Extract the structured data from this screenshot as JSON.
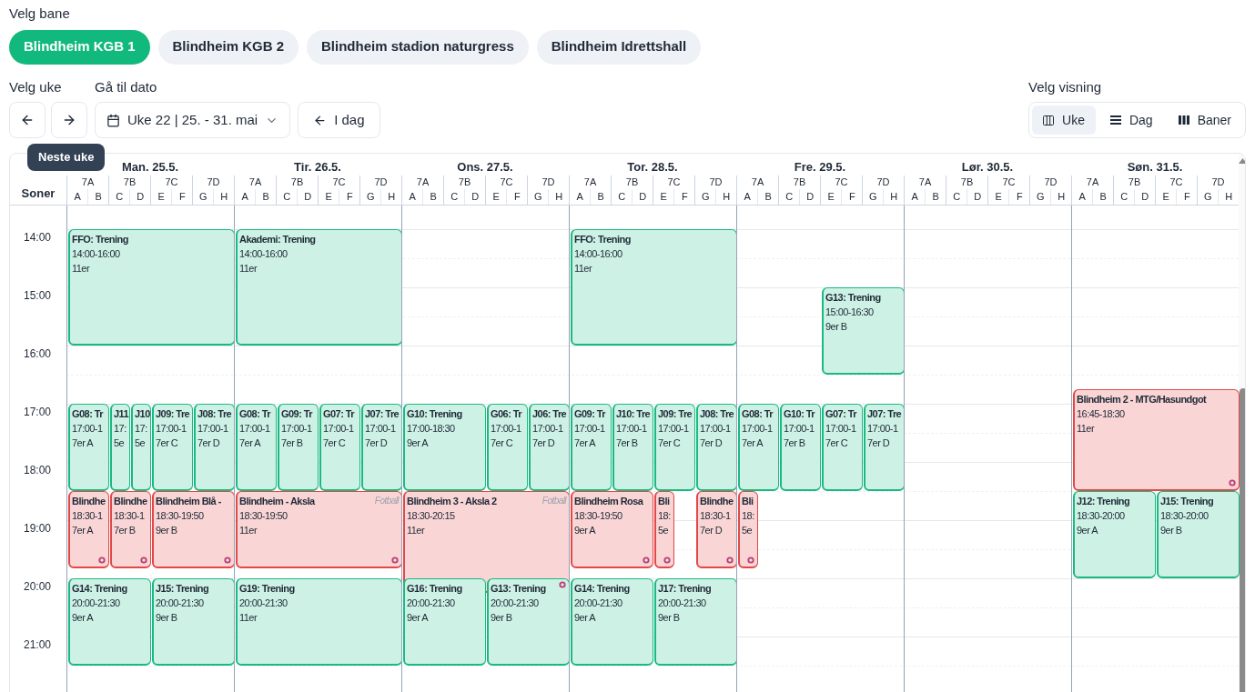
{
  "field_picker": {
    "label": "Velg bane",
    "options": [
      {
        "label": "Blindheim KGB 1",
        "selected": true
      },
      {
        "label": "Blindheim KGB 2",
        "selected": false
      },
      {
        "label": "Blindheim stadion naturgress",
        "selected": false
      },
      {
        "label": "Blindheim Idrettshall",
        "selected": false
      }
    ]
  },
  "week_picker": {
    "label": "Velg uke",
    "date_label": "Gå til dato",
    "date_value": "Uke 22 | 25. - 31. mai",
    "today_button": "I dag",
    "tooltip": "Neste uke"
  },
  "view_picker": {
    "label": "Velg visning",
    "options": [
      {
        "label": "Uke",
        "selected": true,
        "kind": "week"
      },
      {
        "label": "Dag",
        "selected": false,
        "kind": "day"
      },
      {
        "label": "Baner",
        "selected": false,
        "kind": "fields"
      }
    ]
  },
  "calendar": {
    "zones_label": "Soner",
    "times": [
      "14:00",
      "15:00",
      "16:00",
      "17:00",
      "18:00",
      "19:00",
      "20:00",
      "21:00"
    ],
    "days": [
      {
        "label": "Man. 25.5.",
        "groups": [
          {
            "label": "7A",
            "zones": [
              "A",
              "B"
            ]
          },
          {
            "label": "7B",
            "zones": [
              "C",
              "D"
            ]
          },
          {
            "label": "7C",
            "zones": [
              "E",
              "F"
            ]
          },
          {
            "label": "7D",
            "zones": [
              "G",
              "H"
            ]
          }
        ],
        "events": [
          {
            "title": "FFO: Trening",
            "time": "14:00-16:00",
            "team": "11er",
            "kind": "training"
          },
          {
            "title": "G08: Tr",
            "time": "17:00-1",
            "team": "7er A",
            "kind": "training"
          },
          {
            "title": "J11",
            "time": "17:",
            "team": "5e",
            "kind": "training"
          },
          {
            "title": "J10",
            "time": "17:",
            "team": "5e",
            "kind": "training"
          },
          {
            "title": "J09: Tre",
            "time": "17:00-1",
            "team": "7er C",
            "kind": "training"
          },
          {
            "title": "J08: Tre",
            "time": "17:00-1",
            "team": "7er D",
            "kind": "training"
          },
          {
            "title": "Blindhe",
            "time": "18:30-1",
            "team": "7er A",
            "kind": "match"
          },
          {
            "title": "Blindhe",
            "time": "18:30-1",
            "team": "7er B",
            "kind": "match"
          },
          {
            "title": "Blindheim Blå -",
            "time": "18:30-19:50",
            "team": "9er B",
            "kind": "match"
          },
          {
            "title": "G14: Trening",
            "time": "20:00-21:30",
            "team": "9er A",
            "kind": "training"
          },
          {
            "title": "J15: Trening",
            "time": "20:00-21:30",
            "team": "9er B",
            "kind": "training"
          }
        ]
      },
      {
        "label": "Tir. 26.5.",
        "groups": [
          {
            "label": "7A",
            "zones": [
              "A",
              "B"
            ]
          },
          {
            "label": "7B",
            "zones": [
              "C",
              "D"
            ]
          },
          {
            "label": "7C",
            "zones": [
              "E",
              "F"
            ]
          },
          {
            "label": "7D",
            "zones": [
              "G",
              "H"
            ]
          }
        ],
        "events": [
          {
            "title": "Akademi: Trening",
            "time": "14:00-16:00",
            "team": "11er",
            "kind": "training"
          },
          {
            "title": "G08: Tr",
            "time": "17:00-1",
            "team": "7er A",
            "kind": "training"
          },
          {
            "title": "G09: Tr",
            "time": "17:00-1",
            "team": "7er B",
            "kind": "training"
          },
          {
            "title": "G07: Tr",
            "time": "17:00-1",
            "team": "7er C",
            "kind": "training"
          },
          {
            "title": "J07: Tre",
            "time": "17:00-1",
            "team": "7er D",
            "kind": "training"
          },
          {
            "title": "Blindheim - Aksla",
            "tag": "Fotball",
            "time": "18:30-19:50",
            "team": "11er",
            "kind": "match"
          },
          {
            "title": "G19: Trening",
            "time": "20:00-21:30",
            "team": "11er",
            "kind": "training"
          }
        ]
      },
      {
        "label": "Ons. 27.5.",
        "groups": [
          {
            "label": "7A",
            "zones": [
              "A",
              "B"
            ]
          },
          {
            "label": "7B",
            "zones": [
              "C",
              "D"
            ]
          },
          {
            "label": "7C",
            "zones": [
              "E",
              "F"
            ]
          },
          {
            "label": "7D",
            "zones": [
              "G",
              "H"
            ]
          }
        ],
        "events": [
          {
            "title": "G10: Trening",
            "time": "17:00-18:30",
            "team": "9er A",
            "kind": "training"
          },
          {
            "title": "G06: Tr",
            "time": "17:00-1",
            "team": "7er C",
            "kind": "training"
          },
          {
            "title": "J06: Tre",
            "time": "17:00-1",
            "team": "7er D",
            "kind": "training"
          },
          {
            "title": "Blindheim 3 - Aksla 2",
            "tag": "Fotball",
            "time": "18:30-20:15",
            "team": "11er",
            "kind": "match"
          },
          {
            "title": "G16: Trening",
            "time": "20:00-21:30",
            "team": "9er A",
            "kind": "training"
          },
          {
            "title": "G13: Trening",
            "time": "20:00-21:30",
            "team": "9er B",
            "kind": "training"
          }
        ]
      },
      {
        "label": "Tor. 28.5.",
        "groups": [
          {
            "label": "7A",
            "zones": [
              "A",
              "B"
            ]
          },
          {
            "label": "7B",
            "zones": [
              "C",
              "D"
            ]
          },
          {
            "label": "7C",
            "zones": [
              "E",
              "F"
            ]
          },
          {
            "label": "7D",
            "zones": [
              "G",
              "H"
            ]
          }
        ],
        "events": [
          {
            "title": "FFO: Trening",
            "time": "14:00-16:00",
            "team": "11er",
            "kind": "training"
          },
          {
            "title": "G09: Tr",
            "time": "17:00-1",
            "team": "7er A",
            "kind": "training"
          },
          {
            "title": "J10: Tre",
            "time": "17:00-1",
            "team": "7er B",
            "kind": "training"
          },
          {
            "title": "J09: Tre",
            "time": "17:00-1",
            "team": "7er C",
            "kind": "training"
          },
          {
            "title": "J08: Tre",
            "time": "17:00-1",
            "team": "7er D",
            "kind": "training"
          },
          {
            "title": "Blindheim Rosa",
            "time": "18:30-19:50",
            "team": "9er A",
            "kind": "match"
          },
          {
            "title": "Bli",
            "time": "18:",
            "team": "5e",
            "kind": "match"
          },
          {
            "title": "Blindhe",
            "time": "18:30-1",
            "team": "7er D",
            "kind": "match"
          },
          {
            "title": "G14: Trening",
            "time": "20:00-21:30",
            "team": "9er A",
            "kind": "training"
          },
          {
            "title": "J17: Trening",
            "time": "20:00-21:30",
            "team": "9er B",
            "kind": "training"
          }
        ]
      },
      {
        "label": "Fre. 29.5.",
        "groups": [
          {
            "label": "7A",
            "zones": [
              "A",
              "B"
            ]
          },
          {
            "label": "7B",
            "zones": [
              "C",
              "D"
            ]
          },
          {
            "label": "7C",
            "zones": [
              "E",
              "F"
            ]
          },
          {
            "label": "7D",
            "zones": [
              "G",
              "H"
            ]
          }
        ],
        "events": [
          {
            "title": "G13: Trening",
            "time": "15:00-16:30",
            "team": "9er B",
            "kind": "training"
          },
          {
            "title": "G08: Tr",
            "time": "17:00-1",
            "team": "7er A",
            "kind": "training"
          },
          {
            "title": "G10: Tr",
            "time": "17:00-1",
            "team": "7er B",
            "kind": "training"
          },
          {
            "title": "G07: Tr",
            "time": "17:00-1",
            "team": "7er C",
            "kind": "training"
          },
          {
            "title": "J07: Tre",
            "time": "17:00-1",
            "team": "7er D",
            "kind": "training"
          },
          {
            "title": "Bli",
            "time": "18:",
            "team": "5e",
            "kind": "match"
          }
        ]
      },
      {
        "label": "Lør. 30.5.",
        "groups": [
          {
            "label": "7A",
            "zones": [
              "A",
              "B"
            ]
          },
          {
            "label": "7B",
            "zones": [
              "C",
              "D"
            ]
          },
          {
            "label": "7C",
            "zones": [
              "E",
              "F"
            ]
          },
          {
            "label": "7D",
            "zones": [
              "G",
              "H"
            ]
          }
        ]
      },
      {
        "label": "Søn. 31.5.",
        "groups": [
          {
            "label": "7A",
            "zones": [
              "A",
              "B"
            ]
          },
          {
            "label": "7B",
            "zones": [
              "C",
              "D"
            ]
          },
          {
            "label": "7C",
            "zones": [
              "E",
              "F"
            ]
          },
          {
            "label": "7D",
            "zones": [
              "G",
              "H"
            ]
          }
        ],
        "events": [
          {
            "title": "Blindheim 2 - MTG/Hasundgot",
            "time": "16:45-18:30",
            "team": "11er",
            "kind": "match"
          },
          {
            "title": "J12: Trening",
            "time": "18:30-20:00",
            "team": "9er A",
            "kind": "training"
          },
          {
            "title": "J15: Trening",
            "time": "18:30-20:00",
            "team": "9er B",
            "kind": "training"
          }
        ]
      }
    ]
  }
}
